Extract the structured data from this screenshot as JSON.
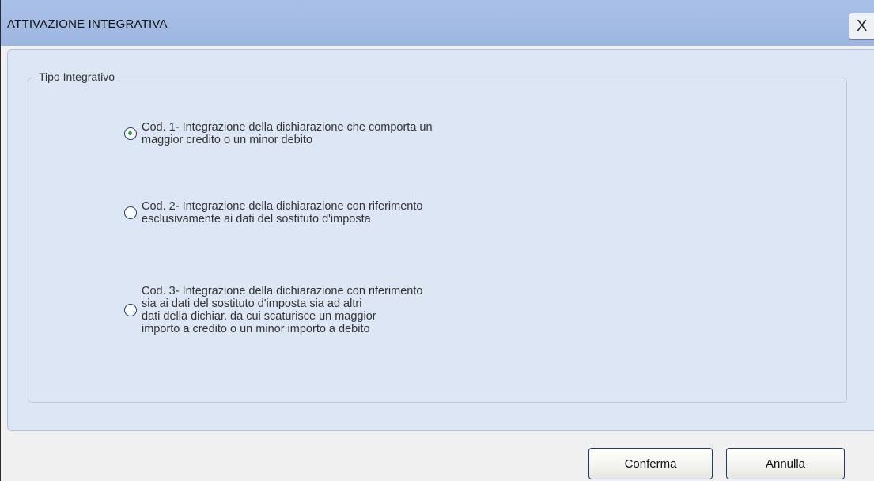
{
  "window": {
    "title": "ATTIVAZIONE INTEGRATIVA",
    "close_label": "X"
  },
  "group": {
    "legend": "Tipo Integrativo",
    "selected_option": 1,
    "options": [
      {
        "code": 1,
        "selected": true,
        "lines": [
          "Cod. 1- Integrazione della dichiarazione che comporta un",
          "maggior credito o un minor debito"
        ]
      },
      {
        "code": 2,
        "selected": false,
        "lines": [
          "Cod. 2- Integrazione della dichiarazione con riferimento",
          "esclusivamente ai dati del sostituto d'imposta"
        ]
      },
      {
        "code": 3,
        "selected": false,
        "lines": [
          "Cod. 3- Integrazione della dichiarazione con riferimento",
          "sia ai dati del sostituto d'imposta sia ad altri",
          "dati della dichiar. da cui scaturisce un maggior",
          "importo a credito o un minor importo a debito"
        ]
      }
    ]
  },
  "buttons": {
    "confirm": "Conferma",
    "cancel": "Annulla"
  },
  "colors": {
    "titlebar": "#a3bbe3",
    "panel": "#dde6f4",
    "radio_dot": "#3aa53a"
  }
}
